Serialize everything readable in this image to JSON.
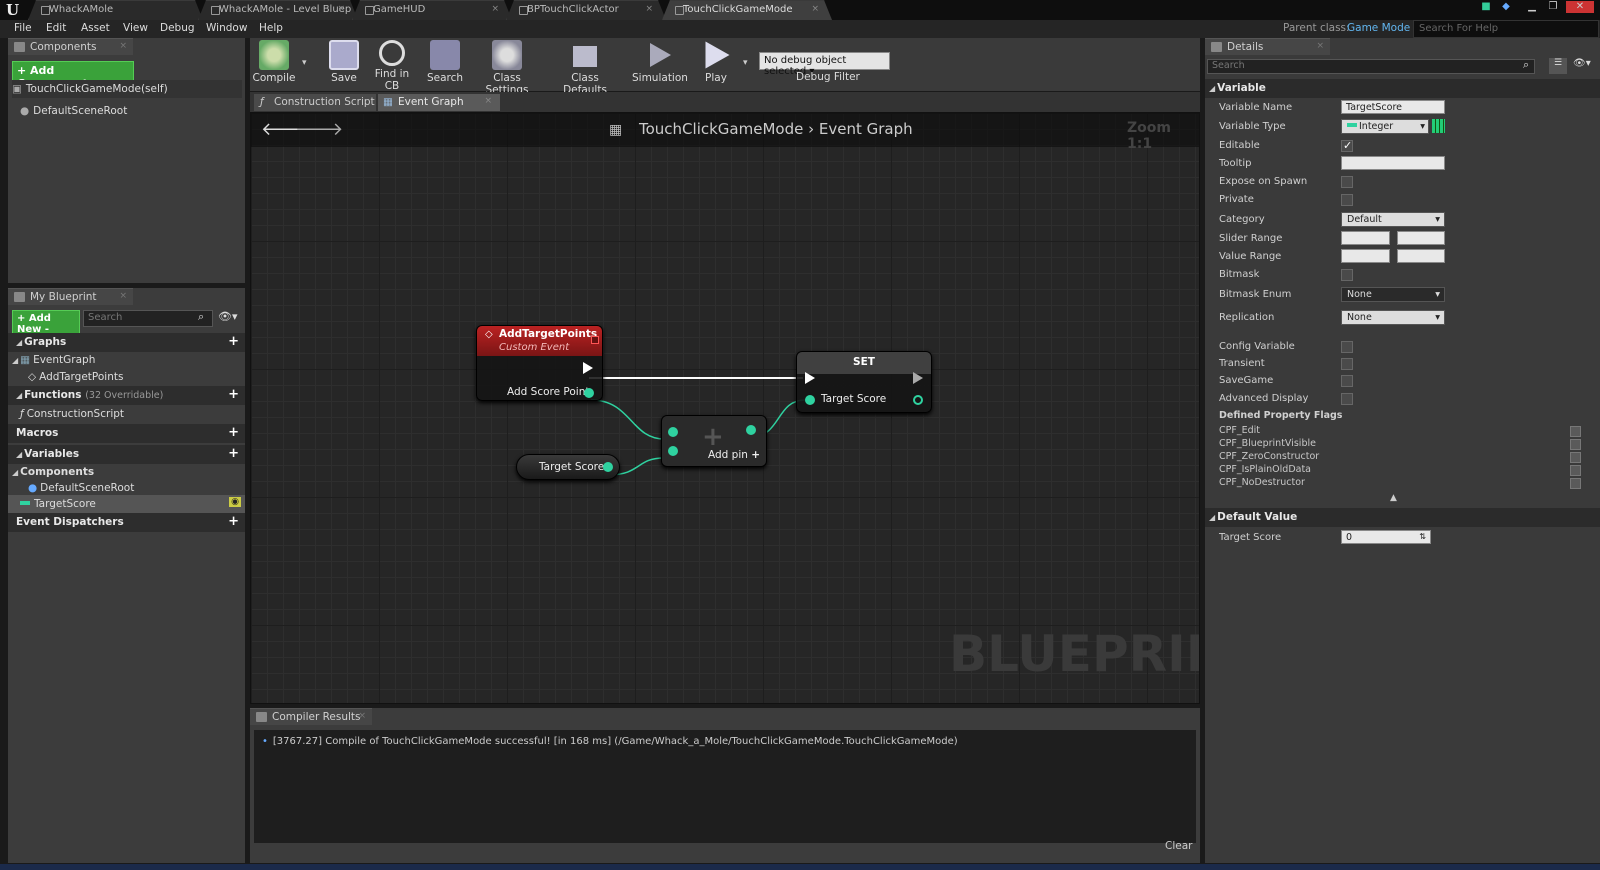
{
  "window_tabs": [
    "WhackAMole",
    "WhackAMole - Level Bluep",
    "GameHUD",
    "BPTouchClickActor",
    "TouchClickGameMode"
  ],
  "menu": [
    "File",
    "Edit",
    "Asset",
    "View",
    "Debug",
    "Window",
    "Help"
  ],
  "parent_class": {
    "label": "Parent class:",
    "value": "Game Mode"
  },
  "search_help": "Search For Help",
  "components": {
    "tab": "Components",
    "add_button": "+ Add Component -",
    "items": [
      "TouchClickGameMode(self)",
      "DefaultSceneRoot"
    ]
  },
  "toolbar": {
    "compile": "Compile",
    "save": "Save",
    "find_in_cb": "Find in CB",
    "search": "Search",
    "class_settings": "Class Settings",
    "class_defaults": "Class Defaults",
    "simulation": "Simulation",
    "play": "Play",
    "debug_select": "No debug object selected",
    "debug_filter": "Debug Filter"
  },
  "graph_tabs": [
    "Construction Script",
    "Event Graph"
  ],
  "breadcrumb": {
    "class": "TouchClickGameMode",
    "graph": "Event Graph",
    "zoom": "Zoom 1:1"
  },
  "watermark": "BLUEPRINT",
  "nodes": {
    "event": {
      "title": "AddTargetPoints",
      "subtitle": "Custom Event",
      "pin": "Add Score Point"
    },
    "set": {
      "title": "SET",
      "pin": "Target Score"
    },
    "getter": {
      "label": "Target Score"
    },
    "add": {
      "addpin": "Add pin"
    }
  },
  "my_blueprint": {
    "tab": "My Blueprint",
    "add_new": "+ Add New -",
    "search_placeholder": "Search",
    "sections": {
      "graphs": "Graphs",
      "event_graph": "EventGraph",
      "add_target_points": "AddTargetPoints",
      "functions": "Functions",
      "functions_note": "(32 Overridable)",
      "construction_script": "ConstructionScript",
      "macros": "Macros",
      "variables": "Variables",
      "components": "Components",
      "default_scene_root": "DefaultSceneRoot",
      "target_score": "TargetScore",
      "event_dispatchers": "Event Dispatchers"
    }
  },
  "compiler": {
    "tab": "Compiler Results",
    "message": "[3767.27] Compile of TouchClickGameMode successful! [in 168 ms] (/Game/Whack_a_Mole/TouchClickGameMode.TouchClickGameMode)",
    "clear": "Clear"
  },
  "details": {
    "tab": "Details",
    "search_placeholder": "Search",
    "section_variable": "Variable",
    "variable_name_label": "Variable Name",
    "variable_name": "TargetScore",
    "variable_type_label": "Variable Type",
    "variable_type": "Integer",
    "editable": "Editable",
    "tooltip": "Tooltip",
    "expose": "Expose on Spawn",
    "private": "Private",
    "category_label": "Category",
    "category": "Default",
    "slider_range": "Slider Range",
    "value_range": "Value Range",
    "bitmask": "Bitmask",
    "bitmask_enum_label": "Bitmask Enum",
    "bitmask_enum": "None",
    "replication_label": "Replication",
    "replication": "None",
    "config_variable": "Config Variable",
    "transient": "Transient",
    "savegame": "SaveGame",
    "advanced_display": "Advanced Display",
    "defined_flags": "Defined Property Flags",
    "flags": [
      "CPF_Edit",
      "CPF_BlueprintVisible",
      "CPF_ZeroConstructor",
      "CPF_IsPlainOldData",
      "CPF_NoDestructor"
    ],
    "section_default": "Default Value",
    "default_label": "Target Score",
    "default_value": "0"
  },
  "colors": {
    "accent_blue": "#62b6f0",
    "event_red": "#b22222",
    "pin_green": "#2fd2a0",
    "add_green": "#3aa23a"
  }
}
